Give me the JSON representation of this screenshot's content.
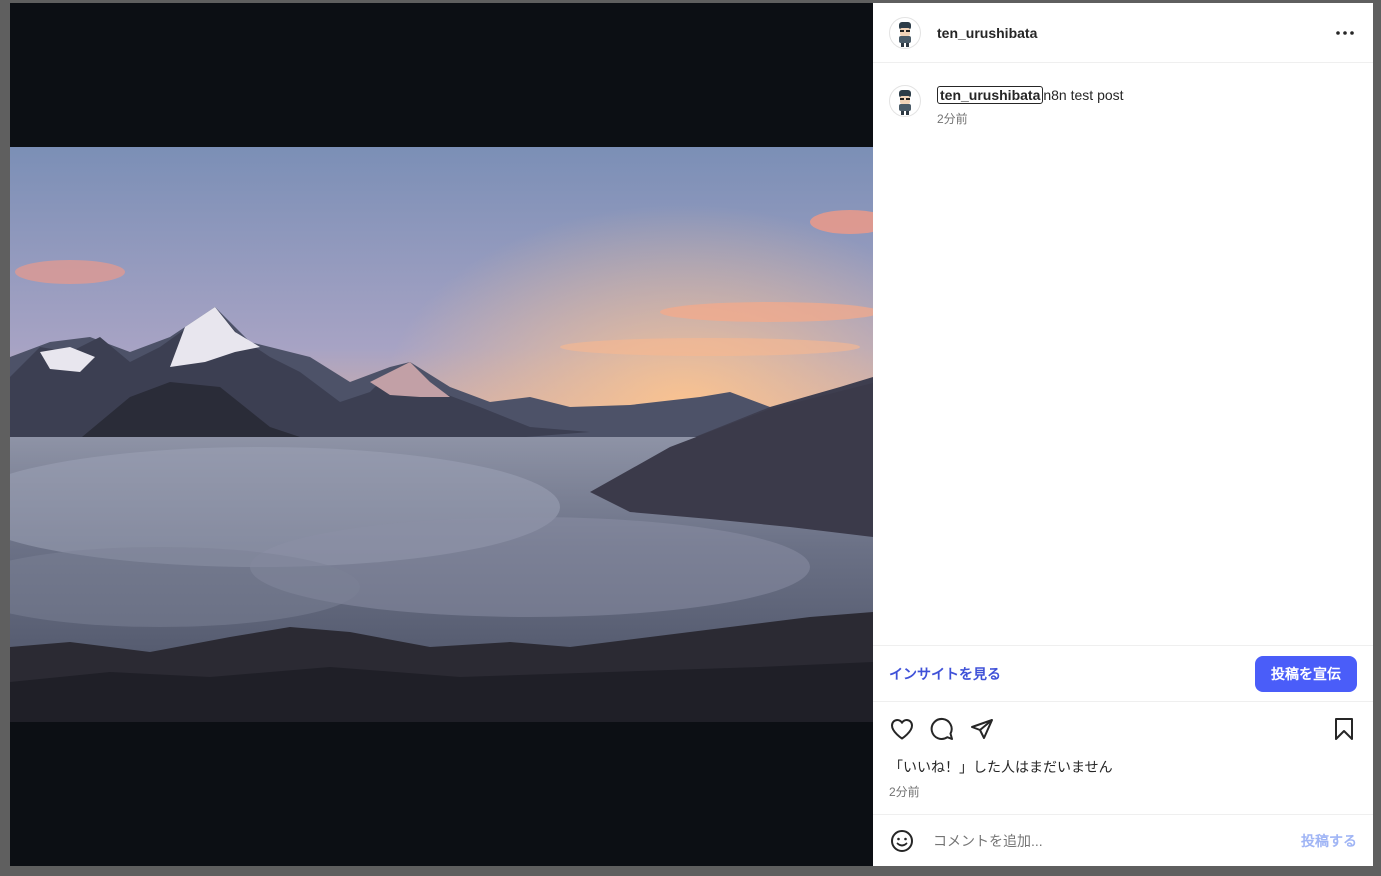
{
  "post": {
    "author": "ten_urushibata",
    "caption_username": "ten_urushibata",
    "caption_text": "n8n test post",
    "caption_time": "2分前"
  },
  "insights": {
    "view_label": "インサイトを見る",
    "promote_label": "投稿を宣伝"
  },
  "actions": {
    "likes_text": "「いいね！」した人はまだいません",
    "timestamp": "2分前"
  },
  "comment": {
    "placeholder": "コメントを追加...",
    "post_label": "投稿する"
  },
  "icons": [
    "more-icon",
    "heart-icon",
    "comment-icon",
    "share-icon",
    "bookmark-icon",
    "emoji-icon"
  ],
  "colors": {
    "link": "#3f51d8",
    "primary_button": "#4a5df9",
    "post_disabled": "#a0b5f5"
  }
}
